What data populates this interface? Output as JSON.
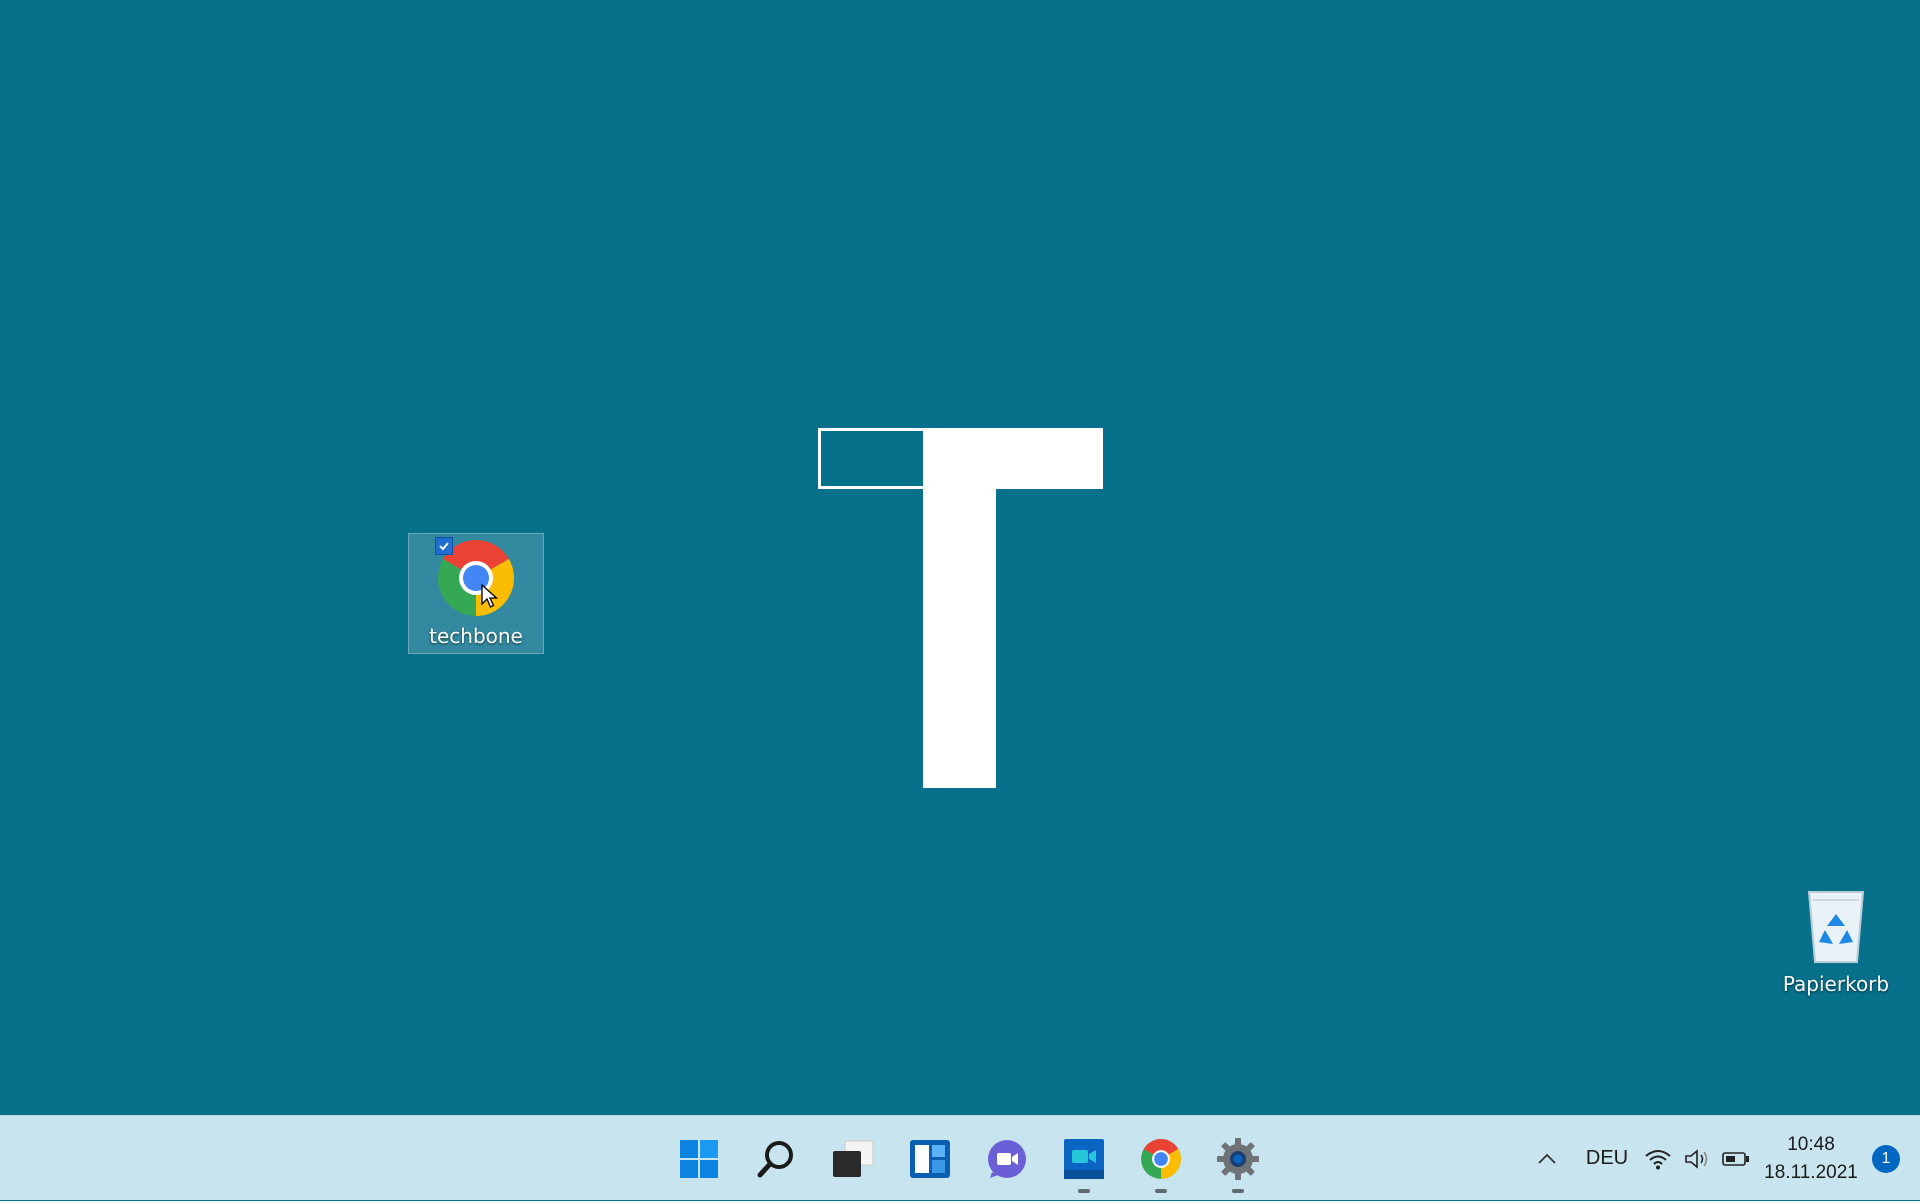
{
  "desktop": {
    "background_color": "#07708b",
    "icons": [
      {
        "label": "techbone",
        "icon": "chrome-icon",
        "selected": true
      },
      {
        "label": "Papierkorb",
        "icon": "recycle-bin-icon"
      }
    ]
  },
  "taskbar": {
    "pinned": [
      {
        "name": "start",
        "icon": "windows-start-icon",
        "running": false
      },
      {
        "name": "search",
        "icon": "search-icon",
        "running": false
      },
      {
        "name": "task-view",
        "icon": "task-view-icon",
        "running": false
      },
      {
        "name": "widgets",
        "icon": "widgets-icon",
        "running": false
      },
      {
        "name": "chat",
        "icon": "teams-chat-icon",
        "running": false
      },
      {
        "name": "video",
        "icon": "video-app-icon",
        "running": true
      },
      {
        "name": "chrome",
        "icon": "chrome-icon",
        "running": true
      },
      {
        "name": "settings",
        "icon": "settings-gear-icon",
        "running": true
      }
    ],
    "tray": {
      "language": "DEU",
      "time": "10:48",
      "date": "18.11.2021",
      "notification_count": "1"
    }
  }
}
